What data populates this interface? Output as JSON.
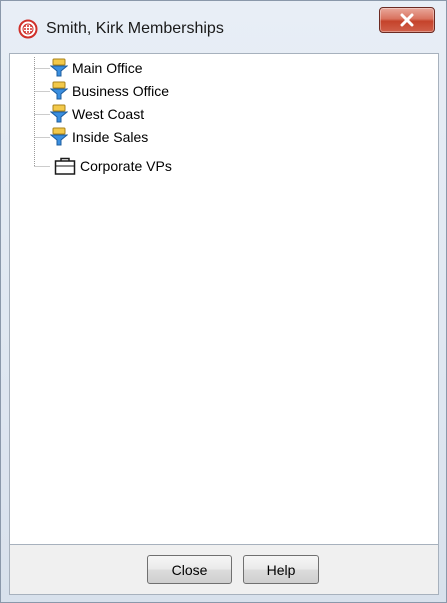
{
  "window": {
    "title": "Smith, Kirk Memberships"
  },
  "tree": {
    "items": [
      {
        "label": "Main Office",
        "icon": "funnel-icon"
      },
      {
        "label": "Business Office",
        "icon": "funnel-icon"
      },
      {
        "label": "West Coast",
        "icon": "funnel-icon"
      },
      {
        "label": "Inside Sales",
        "icon": "funnel-icon"
      },
      {
        "label": "Corporate VPs",
        "icon": "briefcase-icon"
      }
    ]
  },
  "buttons": {
    "close_label": "Close",
    "help_label": "Help"
  },
  "colors": {
    "accent_funnel_blue": "#3a8fe0",
    "accent_funnel_yellow": "#f3c94a",
    "title_icon_red": "#d0302a",
    "close_button_red": "#c5432b"
  }
}
